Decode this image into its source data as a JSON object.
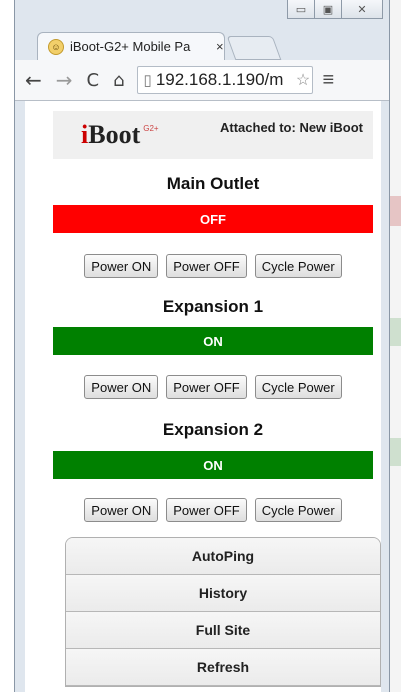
{
  "browser": {
    "tab_title": "iBoot-G2+ Mobile Pa",
    "tab_close": "×",
    "url": "192.168.1.190/m",
    "window_controls": {
      "minimize": "▭",
      "restore": "▣",
      "close": "✕"
    }
  },
  "header": {
    "logo_i": "i",
    "logo_text": "Boot",
    "logo_sup": "G2+",
    "attached_text": "Attached to: New iBoot"
  },
  "outlets": [
    {
      "title": "Main Outlet",
      "status": "OFF",
      "status_color": "#ff0000"
    },
    {
      "title": "Expansion 1",
      "status": "ON",
      "status_color": "#008000"
    },
    {
      "title": "Expansion 2",
      "status": "ON",
      "status_color": "#008000"
    }
  ],
  "buttons": {
    "power_on": "Power ON",
    "power_off": "Power OFF",
    "cycle": "Cycle Power"
  },
  "menu": [
    "AutoPing",
    "History",
    "Full Site",
    "Refresh"
  ]
}
